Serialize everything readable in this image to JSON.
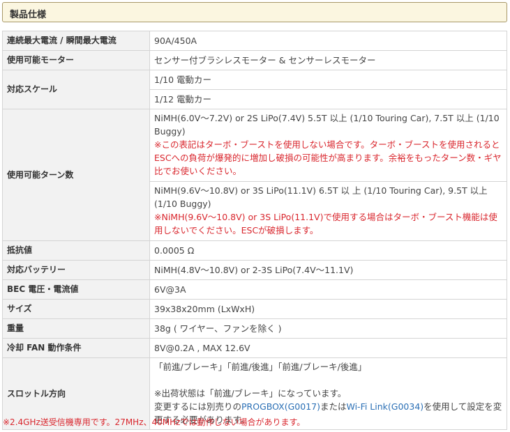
{
  "section": {
    "title": "製品仕様"
  },
  "rows": {
    "current": {
      "label": "連続最大電流 / 瞬間最大電流",
      "value": "90A/450A"
    },
    "motor": {
      "label": "使用可能モーター",
      "value": "センサー付ブラシレスモーター & センサーレスモーター"
    },
    "scale": {
      "label": "対応スケール",
      "value1": "1/10 電動カー",
      "value2": "1/12 電動カー"
    },
    "turn": {
      "label": "使用可能ターン数",
      "block1": "NiMH(6.0V〜7.2V) or 2S LiPo(7.4V) 5.5T 以上 (1/10 Touring Car), 7.5T 以上 (1/10 Buggy)",
      "note1": "※この表記はターボ・ブーストを使用しない場合です。ターボ・ブーストを使用されるとESCへの負荷が爆発的に増加し破損の可能性が高まります。余裕をもったターン数・ギヤ比でお使いください。",
      "block2": "NiMH(9.6V〜10.8V) or 3S LiPo(11.1V) 6.5T 以 上 (1/10 Touring Car), 9.5T 以上 (1/10 Buggy)",
      "note2": "※NiMH(9.6V〜10.8V) or 3S LiPo(11.1V)で使用する場合はターボ・ブースト機能は使用しないでください。ESCが破損します。"
    },
    "resistance": {
      "label": "抵抗値",
      "value": "0.0005 Ω"
    },
    "battery": {
      "label": "対応バッテリー",
      "value": "NiMH(4.8V〜10.8V) or 2-3S LiPo(7.4V〜11.1V)"
    },
    "bec": {
      "label": "BEC 電圧・電流値",
      "value": "6V@3A"
    },
    "size": {
      "label": "サイズ",
      "value": "39x38x20mm (LxWxH)"
    },
    "weight": {
      "label": "重量",
      "value": "38g ( ワイヤー、ファンを除く )"
    },
    "fan": {
      "label": "冷却 FAN 動作条件",
      "value": "8V@0.2A , MAX 12.6V"
    },
    "throttle": {
      "label": "スロットル方向",
      "modes": "「前進/ブレーキ」「前進/後進」「前進/ブレーキ/後進」",
      "shipping": "※出荷状態は「前進/ブレーキ」になっています。",
      "change_pre": "変更するには別売りの",
      "link1": "PROGBOX(G0017)",
      "mid": "または",
      "link2": "Wi-Fi Link(G0034)",
      "change_post": "を使用して設定を変更する必要があります。"
    }
  },
  "footnote": "※2.4GHz送受信機専用です。27MHz、40MHzでは動作しない場合があります。",
  "colors": {
    "header_bg": "#fbf6e0",
    "label_bg": "#f2f2f2",
    "note_red": "#d9262d",
    "link_blue": "#2a6fb5"
  }
}
